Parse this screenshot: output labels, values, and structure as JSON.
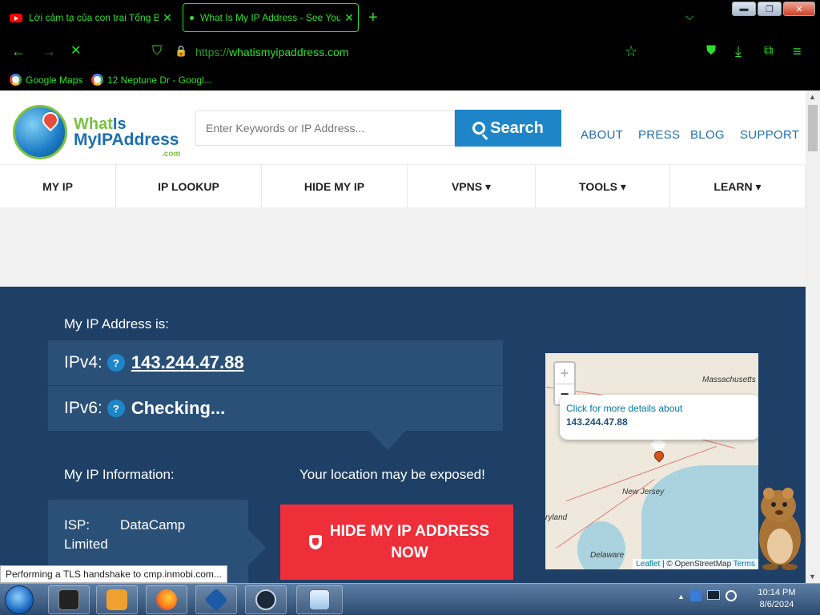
{
  "browser": {
    "tabs": [
      {
        "title": "Lời cảm tạ của con trai Tổng Bí thư",
        "close": "✕"
      },
      {
        "title": "What Is My IP Address - See Your",
        "close": "✕"
      }
    ],
    "new_tab": "+",
    "tab_list": "⌵",
    "window_controls": {
      "minimize": "▬",
      "maximize": "❐",
      "close": "✕"
    },
    "nav": {
      "back": "←",
      "forward": "→",
      "stop": "✕",
      "shield": "⛉",
      "lock": "🔒",
      "star": "☆",
      "pocket": "⛊",
      "download": "⤓",
      "extensions": "⧉",
      "menu": "≡"
    },
    "url": {
      "scheme": "https://",
      "host": "whatismyipaddress.com"
    },
    "bookmarks": [
      {
        "label": "Google Maps"
      },
      {
        "label": "12 Neptune Dr - Googl..."
      }
    ],
    "status_text": "Performing a TLS handshake to cmp.inmobi.com..."
  },
  "site": {
    "logo": {
      "line1_a": "What",
      "line1_b": "Is",
      "line2": "MyIPAddress",
      "suffix": ".com"
    },
    "search": {
      "placeholder": "Enter Keywords or IP Address...",
      "button": "Search"
    },
    "top_links": [
      "ABOUT",
      "PRESS",
      "BLOG",
      "SUPPORT"
    ],
    "nav": [
      "MY IP",
      "IP LOOKUP",
      "HIDE MY IP",
      "VPNS ▾",
      "TOOLS ▾",
      "LEARN ▾"
    ],
    "my_ip_label": "My IP Address is:",
    "ipv4": {
      "label": "IPv4:",
      "help": "?",
      "value": "143.244.47.88"
    },
    "ipv6": {
      "label": "IPv6:",
      "help": "?",
      "value": "Checking..."
    },
    "info_label": "My IP Information:",
    "exposed_label": "Your location may be exposed!",
    "isp": {
      "key": "ISP:",
      "value": "DataCamp",
      "value2": "Limited"
    },
    "hide_button": "HIDE MY IP ADDRESS NOW",
    "map": {
      "zoom_in": "+",
      "zoom_out": "−",
      "popup_text": "Click for more details about",
      "popup_ip": "143.244.47.88",
      "labels": {
        "massachusetts": "Massachusetts",
        "new_jersey": "New Jersey",
        "maryland": "ryland",
        "delaware": "Delaware"
      },
      "attribution": {
        "leaflet": "Leaflet",
        "sep": "| © OpenStreetMap",
        "terms": "Terms"
      }
    }
  },
  "taskbar": {
    "clock_time": "10:14 PM",
    "clock_date": "8/6/2024",
    "tray_up": "▲"
  },
  "colors": {
    "chrome_text": "#2de02d",
    "site_blue": "#1e3f66",
    "search_blue": "#1e86c8",
    "hide_red": "#ee2f3a"
  }
}
